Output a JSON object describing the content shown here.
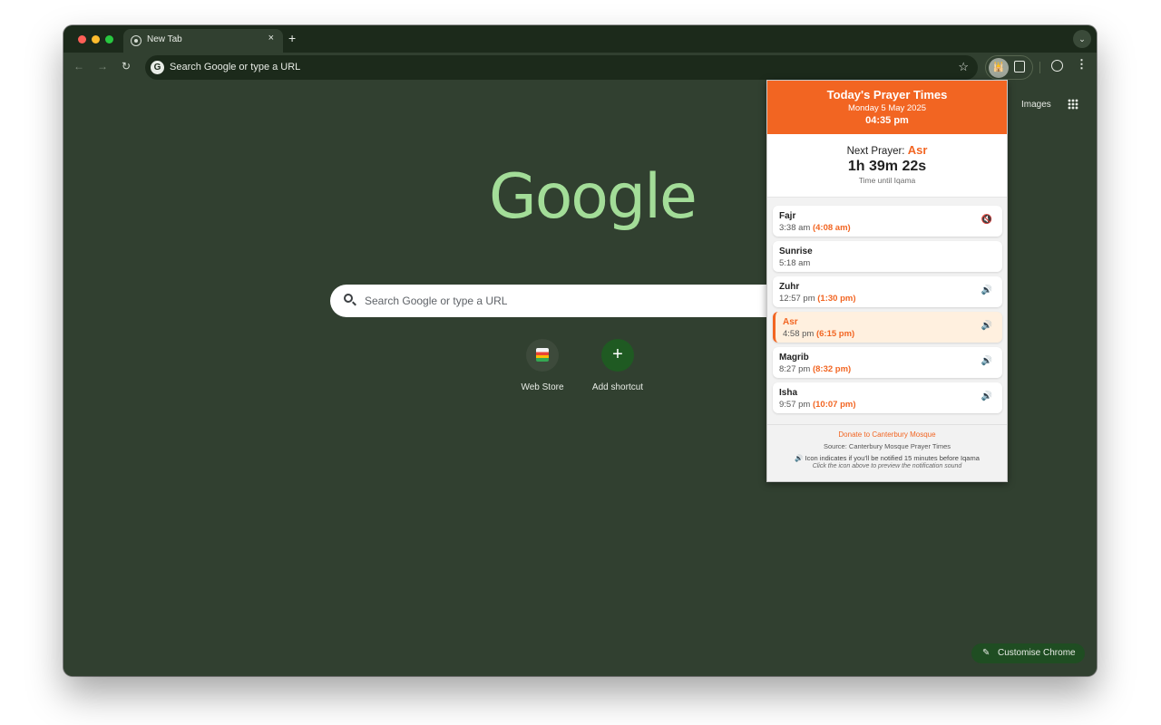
{
  "browser": {
    "tab": {
      "title": "New Tab",
      "close_glyph": "×"
    },
    "new_tab_glyph": "+",
    "tab_search_glyph": "⌄",
    "omnibox": {
      "g_glyph": "G",
      "text": "Search Google or type a URL",
      "star_glyph": "☆"
    },
    "nav": {
      "back_glyph": "←",
      "forward_glyph": "→",
      "reload_glyph": "↻"
    },
    "extension_glyph": "🕌",
    "menu_glyph": "⋮"
  },
  "ntp": {
    "links": {
      "images": "Images"
    },
    "logo": "Google",
    "search_placeholder": "Search Google or type a URL",
    "shortcuts": [
      {
        "label": "Web Store"
      },
      {
        "label": "Add shortcut",
        "glyph": "+"
      }
    ],
    "customise": {
      "label": "Customise Chrome",
      "glyph": "✎"
    }
  },
  "popup": {
    "title": "Today's Prayer Times",
    "date": "Monday 5 May 2025",
    "time": "04:35 pm",
    "next": {
      "label": "Next Prayer:",
      "prayer": "Asr",
      "countdown": "1h 39m 22s",
      "caption": "Time until Iqama"
    },
    "prayers": [
      {
        "name": "Fajr",
        "time": "3:38 am",
        "iqama": "(4:08 am)",
        "sound": "🔇"
      },
      {
        "name": "Sunrise",
        "time": "5:18 am",
        "iqama": "",
        "sound": ""
      },
      {
        "name": "Zuhr",
        "time": "12:57 pm",
        "iqama": "(1:30 pm)",
        "sound": "🔊"
      },
      {
        "name": "Asr",
        "time": "4:58 pm",
        "iqama": "(6:15 pm)",
        "sound": "🔊"
      },
      {
        "name": "Magrib",
        "time": "8:27 pm",
        "iqama": "(8:32 pm)",
        "sound": "🔊"
      },
      {
        "name": "Isha",
        "time": "9:57 pm",
        "iqama": "(10:07 pm)",
        "sound": "🔊"
      }
    ],
    "footer": {
      "donate": "Donate to Canterbury Mosque",
      "source": "Source: Canterbury Mosque Prayer Times",
      "legend_glyph": "🔊",
      "legend": "Icon indicates if you'll be notified 15 minutes before Iqama",
      "hint": "Click the icon above to preview the notification sound"
    }
  },
  "colors": {
    "accent": "#f26522",
    "window_bg": "#314030",
    "logo": "#a3dd98"
  }
}
